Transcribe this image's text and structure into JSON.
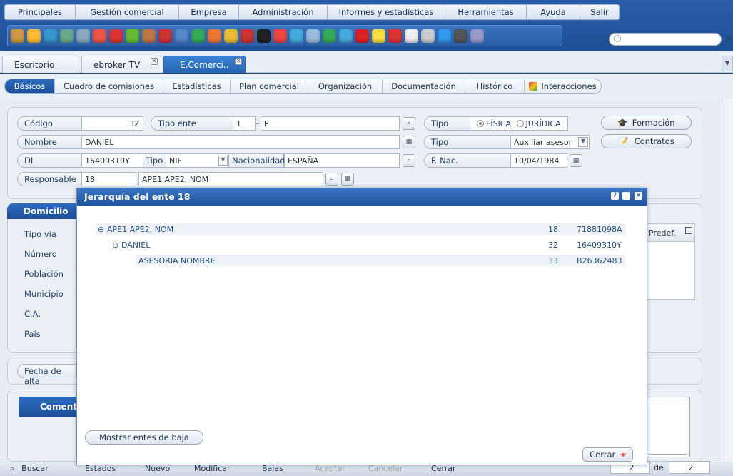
{
  "menu": [
    "Principales",
    "Gestión comercial",
    "Empresa",
    "Administración",
    "Informes y estadísticas",
    "Herramientas",
    "Ayuda",
    "Salir"
  ],
  "toolbar_icons": [
    "cube-icon",
    "user-icon",
    "user-icon",
    "window-icon",
    "window-icon",
    "fire-icon",
    "target-icon",
    "money-icon",
    "briefcase-icon",
    "camera-icon",
    "mail-icon",
    "building-icon",
    "person-icon",
    "person-icon",
    "currency-icon",
    "euro-icon",
    "people-icon",
    "e-icon",
    "eye-icon",
    "euro-icon",
    "refresh-icon",
    "g-icon",
    "bulb-icon",
    "printer-icon",
    "document-icon",
    "document-icon",
    "phone-icon",
    "plug-icon",
    "help-icon"
  ],
  "tabs": {
    "t1": "Escritorio",
    "t2": "ebroker TV",
    "t3": "E.Comerci.."
  },
  "subtabs": [
    "Básicos",
    "Cuadro de comisiones",
    "Estadísticas",
    "Plan comercial",
    "Organización",
    "Documentación",
    "Histórico",
    "Interacciones"
  ],
  "form": {
    "codigo_label": "Código",
    "codigo": "32",
    "tipo_ente_label": "Tipo ente",
    "tipo_ente_num": "1",
    "tipo_ente_sep": "–",
    "tipo_ente_val": "P",
    "tipo_label": "Tipo",
    "fisica": "FÍSICA",
    "juridica": "JURÍDICA",
    "nombre_label": "Nombre",
    "nombre": "DANIEL",
    "tipo2_label": "Tipo",
    "tipo2_val": "Auxiliar asesor",
    "di_label": "DI",
    "di": "16409310Y",
    "di_tipo_label": "Tipo",
    "di_tipo": "NIF",
    "nac_label": "Nacionalidad",
    "nac": "ESPAÑA",
    "fnac_label": "F. Nac.",
    "fnac": "10/04/1984",
    "resp_label": "Responsable",
    "resp": "18",
    "resp_name": "APE1 APE2, NOM",
    "formacion": "Formación",
    "contratos": "Contratos"
  },
  "domicilio": {
    "title": "Domicilio",
    "labels": [
      "Tipo vía",
      "Número",
      "Población",
      "Municipio",
      "C.A.",
      "País"
    ],
    "predef": "Predef."
  },
  "fecha_alta": "Fecha de alta",
  "comentarios": "Comentar",
  "status": {
    "buscar": "Buscar",
    "estados": "Estados",
    "nuevo": "Nuevo",
    "modificar": "Modificar",
    "bajas": "Bajas",
    "aceptar": "Aceptar",
    "cancelar": "Cancelar",
    "cerrar": "Cerrar",
    "page": "2",
    "de": "de",
    "total": "2"
  },
  "modal": {
    "title": "Jerarquía del ente 18",
    "rows": [
      {
        "name": "APE1 APE2, NOM",
        "id": "18",
        "doc": "71881098A"
      },
      {
        "name": "DANIEL",
        "id": "32",
        "doc": "16409310Y"
      },
      {
        "name": "ASESORIA NOMBRE",
        "id": "33",
        "doc": "B26362483"
      }
    ],
    "show_button": "Mostrar entes de baja",
    "close_button": "Cerrar"
  }
}
